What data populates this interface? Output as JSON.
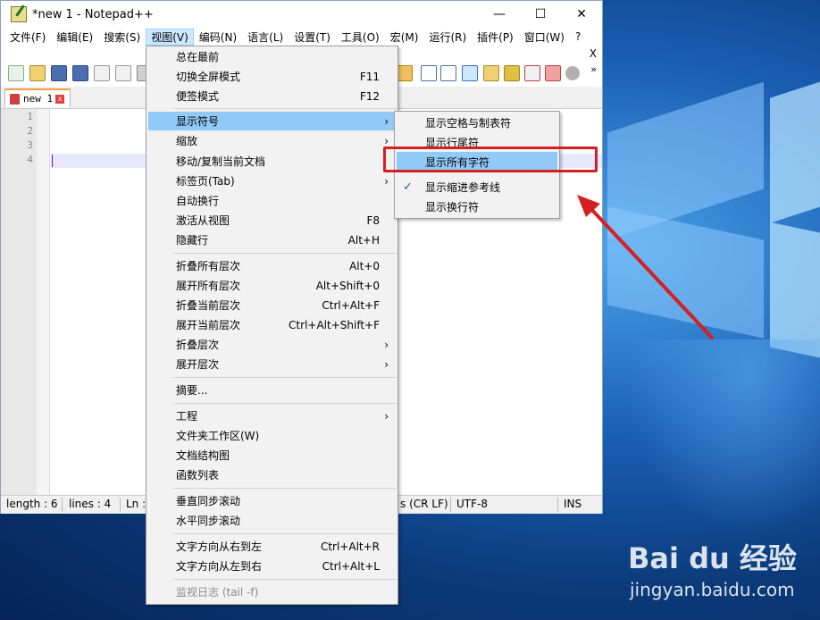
{
  "window": {
    "title": "*new 1 - Notepad++",
    "minimize_glyph": "—",
    "maximize_glyph": "☐",
    "close_glyph": "✕"
  },
  "menubar": {
    "items": [
      "文件(F)",
      "编辑(E)",
      "搜索(S)",
      "视图(V)",
      "编码(N)",
      "语言(L)",
      "设置(T)",
      "工具(O)",
      "宏(M)",
      "运行(R)",
      "插件(P)",
      "窗口(W)",
      "?"
    ],
    "close_doc": "X"
  },
  "toolbar": {
    "overflow": "»"
  },
  "tab": {
    "label": "new 1",
    "close": "x"
  },
  "editor": {
    "line_numbers": [
      "1",
      "2",
      "3",
      "4"
    ]
  },
  "statusbar": {
    "length": "length : 6",
    "lines": "lines : 4",
    "ln": "Ln :",
    "eol": "s (CR LF)",
    "encoding": "UTF-8",
    "mode": "INS"
  },
  "view_menu": {
    "items": [
      {
        "label": "总在最前",
        "shortcut": ""
      },
      {
        "label": "切换全屏模式",
        "shortcut": "F11"
      },
      {
        "label": "便签模式",
        "shortcut": "F12"
      },
      {
        "label": "显示符号",
        "shortcut": ""
      },
      {
        "label": "缩放",
        "shortcut": ""
      },
      {
        "label": "移动/复制当前文档",
        "shortcut": ""
      },
      {
        "label": "标签页(Tab)",
        "shortcut": ""
      },
      {
        "label": "自动换行",
        "shortcut": ""
      },
      {
        "label": "激活从视图",
        "shortcut": "F8"
      },
      {
        "label": "隐藏行",
        "shortcut": "Alt+H"
      },
      {
        "label": "折叠所有层次",
        "shortcut": "Alt+0"
      },
      {
        "label": "展开所有层次",
        "shortcut": "Alt+Shift+0"
      },
      {
        "label": "折叠当前层次",
        "shortcut": "Ctrl+Alt+F"
      },
      {
        "label": "展开当前层次",
        "shortcut": "Ctrl+Alt+Shift+F"
      },
      {
        "label": "折叠层次",
        "shortcut": ""
      },
      {
        "label": "展开层次",
        "shortcut": ""
      },
      {
        "label": "摘要...",
        "shortcut": ""
      },
      {
        "label": "工程",
        "shortcut": ""
      },
      {
        "label": "文件夹工作区(W)",
        "shortcut": ""
      },
      {
        "label": "文档结构图",
        "shortcut": ""
      },
      {
        "label": "函数列表",
        "shortcut": ""
      },
      {
        "label": "垂直同步滚动",
        "shortcut": ""
      },
      {
        "label": "水平同步滚动",
        "shortcut": ""
      },
      {
        "label": "文字方向从右到左",
        "shortcut": "Ctrl+Alt+R"
      },
      {
        "label": "文字方向从左到右",
        "shortcut": "Ctrl+Alt+L"
      },
      {
        "label": "监视日志 (tail -f)",
        "shortcut": ""
      }
    ],
    "arrow_glyph": "›"
  },
  "symbol_submenu": {
    "items": [
      {
        "label": "显示空格与制表符",
        "checked": false
      },
      {
        "label": "显示行尾符",
        "checked": false
      },
      {
        "label": "显示所有字符",
        "checked": false
      },
      {
        "label": "显示缩进参考线",
        "checked": true
      },
      {
        "label": "显示换行符",
        "checked": false
      }
    ],
    "check_glyph": "✓"
  },
  "watermark": {
    "logo": "Bai du 经验",
    "url": "jingyan.baidu.com"
  },
  "colors": {
    "highlight": "#91c9f7",
    "annotation": "#d42020",
    "menu_bg": "#f2f2f2"
  }
}
